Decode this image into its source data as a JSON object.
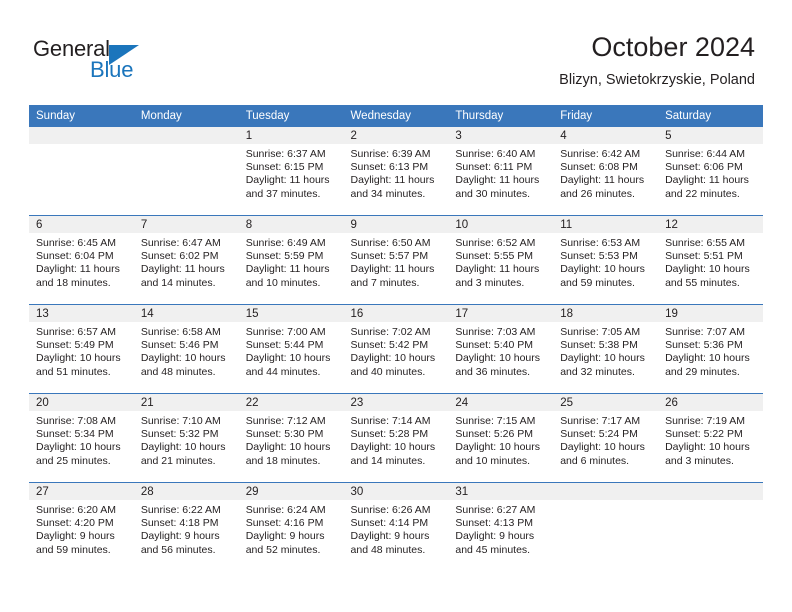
{
  "brand": {
    "word1": "General",
    "word2": "Blue",
    "logo_color": "#1b75bc"
  },
  "header": {
    "title": "October 2024",
    "subtitle": "Blizyn, Swietokrzyskie, Poland"
  },
  "theme": {
    "header_blue": "#3a77bb",
    "daynum_band": "#f0f0f0",
    "text": "#231f20"
  },
  "calendar": {
    "weekday_headers": [
      "Sunday",
      "Monday",
      "Tuesday",
      "Wednesday",
      "Thursday",
      "Friday",
      "Saturday"
    ],
    "labels": {
      "sunrise": "Sunrise:",
      "sunset": "Sunset:",
      "daylight": "Daylight:"
    },
    "weeks": [
      [
        {
          "day": "",
          "empty": true
        },
        {
          "day": "",
          "empty": true
        },
        {
          "day": "1",
          "sunrise": "Sunrise: 6:37 AM",
          "sunset": "Sunset: 6:15 PM",
          "daylight": "Daylight: 11 hours and 37 minutes."
        },
        {
          "day": "2",
          "sunrise": "Sunrise: 6:39 AM",
          "sunset": "Sunset: 6:13 PM",
          "daylight": "Daylight: 11 hours and 34 minutes."
        },
        {
          "day": "3",
          "sunrise": "Sunrise: 6:40 AM",
          "sunset": "Sunset: 6:11 PM",
          "daylight": "Daylight: 11 hours and 30 minutes."
        },
        {
          "day": "4",
          "sunrise": "Sunrise: 6:42 AM",
          "sunset": "Sunset: 6:08 PM",
          "daylight": "Daylight: 11 hours and 26 minutes."
        },
        {
          "day": "5",
          "sunrise": "Sunrise: 6:44 AM",
          "sunset": "Sunset: 6:06 PM",
          "daylight": "Daylight: 11 hours and 22 minutes."
        }
      ],
      [
        {
          "day": "6",
          "sunrise": "Sunrise: 6:45 AM",
          "sunset": "Sunset: 6:04 PM",
          "daylight": "Daylight: 11 hours and 18 minutes."
        },
        {
          "day": "7",
          "sunrise": "Sunrise: 6:47 AM",
          "sunset": "Sunset: 6:02 PM",
          "daylight": "Daylight: 11 hours and 14 minutes."
        },
        {
          "day": "8",
          "sunrise": "Sunrise: 6:49 AM",
          "sunset": "Sunset: 5:59 PM",
          "daylight": "Daylight: 11 hours and 10 minutes."
        },
        {
          "day": "9",
          "sunrise": "Sunrise: 6:50 AM",
          "sunset": "Sunset: 5:57 PM",
          "daylight": "Daylight: 11 hours and 7 minutes."
        },
        {
          "day": "10",
          "sunrise": "Sunrise: 6:52 AM",
          "sunset": "Sunset: 5:55 PM",
          "daylight": "Daylight: 11 hours and 3 minutes."
        },
        {
          "day": "11",
          "sunrise": "Sunrise: 6:53 AM",
          "sunset": "Sunset: 5:53 PM",
          "daylight": "Daylight: 10 hours and 59 minutes."
        },
        {
          "day": "12",
          "sunrise": "Sunrise: 6:55 AM",
          "sunset": "Sunset: 5:51 PM",
          "daylight": "Daylight: 10 hours and 55 minutes."
        }
      ],
      [
        {
          "day": "13",
          "sunrise": "Sunrise: 6:57 AM",
          "sunset": "Sunset: 5:49 PM",
          "daylight": "Daylight: 10 hours and 51 minutes."
        },
        {
          "day": "14",
          "sunrise": "Sunrise: 6:58 AM",
          "sunset": "Sunset: 5:46 PM",
          "daylight": "Daylight: 10 hours and 48 minutes."
        },
        {
          "day": "15",
          "sunrise": "Sunrise: 7:00 AM",
          "sunset": "Sunset: 5:44 PM",
          "daylight": "Daylight: 10 hours and 44 minutes."
        },
        {
          "day": "16",
          "sunrise": "Sunrise: 7:02 AM",
          "sunset": "Sunset: 5:42 PM",
          "daylight": "Daylight: 10 hours and 40 minutes."
        },
        {
          "day": "17",
          "sunrise": "Sunrise: 7:03 AM",
          "sunset": "Sunset: 5:40 PM",
          "daylight": "Daylight: 10 hours and 36 minutes."
        },
        {
          "day": "18",
          "sunrise": "Sunrise: 7:05 AM",
          "sunset": "Sunset: 5:38 PM",
          "daylight": "Daylight: 10 hours and 32 minutes."
        },
        {
          "day": "19",
          "sunrise": "Sunrise: 7:07 AM",
          "sunset": "Sunset: 5:36 PM",
          "daylight": "Daylight: 10 hours and 29 minutes."
        }
      ],
      [
        {
          "day": "20",
          "sunrise": "Sunrise: 7:08 AM",
          "sunset": "Sunset: 5:34 PM",
          "daylight": "Daylight: 10 hours and 25 minutes."
        },
        {
          "day": "21",
          "sunrise": "Sunrise: 7:10 AM",
          "sunset": "Sunset: 5:32 PM",
          "daylight": "Daylight: 10 hours and 21 minutes."
        },
        {
          "day": "22",
          "sunrise": "Sunrise: 7:12 AM",
          "sunset": "Sunset: 5:30 PM",
          "daylight": "Daylight: 10 hours and 18 minutes."
        },
        {
          "day": "23",
          "sunrise": "Sunrise: 7:14 AM",
          "sunset": "Sunset: 5:28 PM",
          "daylight": "Daylight: 10 hours and 14 minutes."
        },
        {
          "day": "24",
          "sunrise": "Sunrise: 7:15 AM",
          "sunset": "Sunset: 5:26 PM",
          "daylight": "Daylight: 10 hours and 10 minutes."
        },
        {
          "day": "25",
          "sunrise": "Sunrise: 7:17 AM",
          "sunset": "Sunset: 5:24 PM",
          "daylight": "Daylight: 10 hours and 6 minutes."
        },
        {
          "day": "26",
          "sunrise": "Sunrise: 7:19 AM",
          "sunset": "Sunset: 5:22 PM",
          "daylight": "Daylight: 10 hours and 3 minutes."
        }
      ],
      [
        {
          "day": "27",
          "sunrise": "Sunrise: 6:20 AM",
          "sunset": "Sunset: 4:20 PM",
          "daylight": "Daylight: 9 hours and 59 minutes."
        },
        {
          "day": "28",
          "sunrise": "Sunrise: 6:22 AM",
          "sunset": "Sunset: 4:18 PM",
          "daylight": "Daylight: 9 hours and 56 minutes."
        },
        {
          "day": "29",
          "sunrise": "Sunrise: 6:24 AM",
          "sunset": "Sunset: 4:16 PM",
          "daylight": "Daylight: 9 hours and 52 minutes."
        },
        {
          "day": "30",
          "sunrise": "Sunrise: 6:26 AM",
          "sunset": "Sunset: 4:14 PM",
          "daylight": "Daylight: 9 hours and 48 minutes."
        },
        {
          "day": "31",
          "sunrise": "Sunrise: 6:27 AM",
          "sunset": "Sunset: 4:13 PM",
          "daylight": "Daylight: 9 hours and 45 minutes."
        },
        {
          "day": "",
          "empty": true
        },
        {
          "day": "",
          "empty": true
        }
      ]
    ]
  }
}
